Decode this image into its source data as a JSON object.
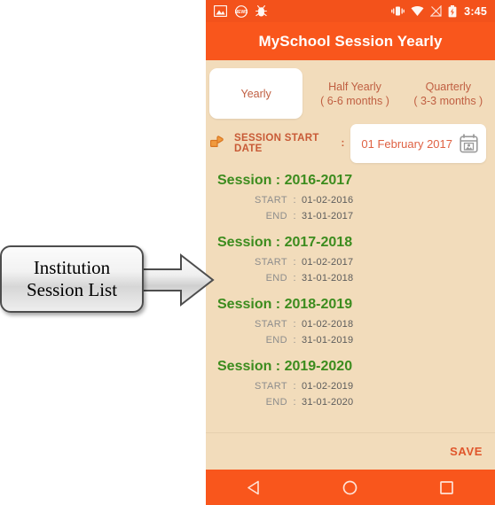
{
  "annotation": {
    "label": "Institution\nSession List",
    "arrow_icon": "right-arrow-icon"
  },
  "phone": {
    "status_bar": {
      "left_icons": [
        "photo-icon",
        "news-icon",
        "bug-icon"
      ],
      "right_icons": [
        "vibrate-icon",
        "wifi-icon",
        "signal-off-icon",
        "battery-charging-icon"
      ],
      "clock": "3:45"
    },
    "app_bar": {
      "title": "MySchool Session Yearly"
    },
    "tabs": [
      {
        "line1": "Yearly",
        "line2": "",
        "selected": true
      },
      {
        "line1": "Half Yearly",
        "line2": "( 6-6 months )",
        "selected": false
      },
      {
        "line1": "Quarterly",
        "line2": "( 3-3 months )",
        "selected": false
      }
    ],
    "start_date": {
      "hand_icon": "pointing-hand-icon",
      "label": "SESSION START DATE",
      "separator": ":",
      "value": "01 February 2017",
      "calendar_icon": "calendar-icon"
    },
    "sessions": [
      {
        "title": "Session : 2016-2017",
        "start_label": "START",
        "start_value": "01-02-2016",
        "end_label": "END",
        "end_value": "31-01-2017",
        "colon": ":"
      },
      {
        "title": "Session : 2017-2018",
        "start_label": "START",
        "start_value": "01-02-2017",
        "end_label": "END",
        "end_value": "31-01-2018",
        "colon": ":"
      },
      {
        "title": "Session : 2018-2019",
        "start_label": "START",
        "start_value": "01-02-2018",
        "end_label": "END",
        "end_value": "31-01-2019",
        "colon": ":"
      },
      {
        "title": "Session : 2019-2020",
        "start_label": "START",
        "start_value": "01-02-2019",
        "end_label": "END",
        "end_value": "31-01-2020",
        "colon": ":"
      }
    ],
    "save": {
      "label": "SAVE"
    },
    "nav_bar": {
      "back": "back-triangle-icon",
      "home": "home-circle-icon",
      "recents": "recents-square-icon"
    }
  },
  "colors": {
    "app_bar_orange": "#f9561c",
    "status_bar_orange": "#f3521b",
    "background_beige": "#f2dcbb",
    "session_green": "#3c8c1e",
    "accent_red": "#df6243",
    "tab_text": "#c05f42",
    "label_gray": "#8c8c8c"
  }
}
